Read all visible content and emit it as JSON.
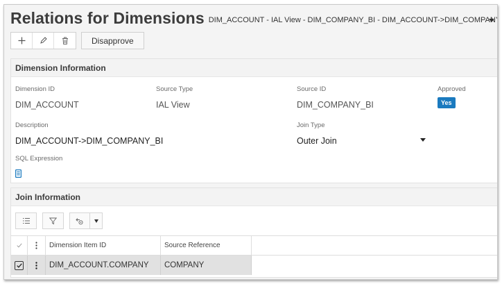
{
  "header": {
    "title": "Relations for Dimensions",
    "subtitle": "DIM_ACCOUNT - IAL View - DIM_COMPANY_BI - DIM_ACCOUNT->DIM_COMPANY_BI"
  },
  "toolbar": {
    "add_icon": "plus-icon",
    "edit_icon": "pencil-icon",
    "delete_icon": "trash-icon",
    "disapprove_label": "Disapprove"
  },
  "dimension_info": {
    "heading": "Dimension Information",
    "dimension_id": {
      "label": "Dimension ID",
      "value": "DIM_ACCOUNT"
    },
    "source_type": {
      "label": "Source Type",
      "value": "IAL View"
    },
    "source_id": {
      "label": "Source ID",
      "value": "DIM_COMPANY_BI"
    },
    "approved": {
      "label": "Approved",
      "value": "Yes"
    },
    "description": {
      "label": "Description",
      "value": "DIM_ACCOUNT->DIM_COMPANY_BI"
    },
    "join_type": {
      "label": "Join Type",
      "value": "Outer Join"
    },
    "sql_expression": {
      "label": "SQL Expression",
      "icon": "document-icon"
    }
  },
  "join_info": {
    "heading": "Join Information",
    "toolbar_icons": [
      "column-chooser-icon",
      "filter-icon",
      "view-settings-icon",
      "chevron-down-icon"
    ],
    "columns": [
      "Dimension Item ID",
      "Source Reference"
    ],
    "rows": [
      {
        "dimension_item_id": "DIM_ACCOUNT.COMPANY",
        "source_reference": "COMPANY",
        "selected": true
      }
    ]
  },
  "colors": {
    "accent": "#1a7abf",
    "selected_row": "#e1e1e1"
  }
}
